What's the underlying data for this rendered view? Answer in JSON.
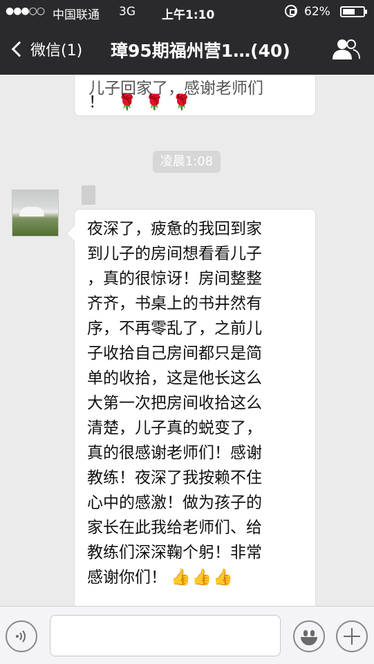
{
  "status_bar": {
    "signal": "●●●○○",
    "carrier": "中国联通",
    "network": "3G",
    "time": "上午1:10",
    "battery_percent": "62%",
    "battery_level": 0.62
  },
  "nav": {
    "back_label": "微信(1)",
    "title": "璋95期福州营1…(40)"
  },
  "chat": {
    "previous_message": {
      "partial_text": "儿子回家了，感谢老师们",
      "tail": "！",
      "roses": "🌹🌹🌹"
    },
    "timestamp": "凌晨1:08",
    "message": {
      "lines": [
        "夜深了，疲惫的我回到家",
        "到儿子的房间想看看儿子",
        "，真的很惊讶！房间整整",
        "齐齐，书桌上的书井然有",
        "序，不再零乱了，之前儿",
        "子收拾自己房间都只是简",
        "单的收拾，这是他长这么",
        "大第一次把房间收拾这么",
        "清楚，儿子真的蜕变了，",
        "真的很感谢老师们！感谢",
        "教练！夜深了我按赖不住",
        "心中的感激！做为孩子的",
        "家长在此我给老师们、给",
        "教练们深深鞠个躬！非常",
        "感谢你们！"
      ],
      "emoji": "👍👍👍"
    }
  },
  "input_bar": {
    "placeholder": ""
  }
}
